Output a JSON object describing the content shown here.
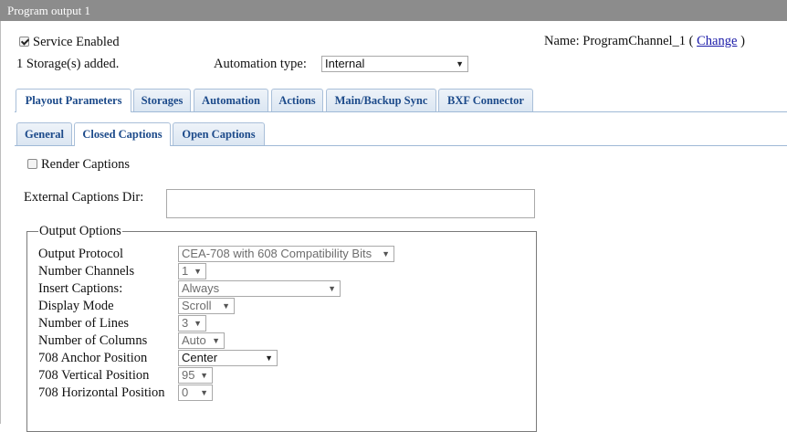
{
  "window": {
    "title": "Program output 1"
  },
  "service": {
    "enabled_label": "Service Enabled",
    "enabled": true,
    "storage_status": "1 Storage(s) added."
  },
  "name": {
    "label": "Name:",
    "value": "ProgramChannel_1",
    "open_paren": "(",
    "change_link": "Change",
    "close_paren": ")"
  },
  "automation": {
    "label": "Automation type:",
    "value": "Internal"
  },
  "main_tabs": [
    {
      "label": "Playout Parameters"
    },
    {
      "label": "Storages"
    },
    {
      "label": "Automation"
    },
    {
      "label": "Actions"
    },
    {
      "label": "Main/Backup Sync"
    },
    {
      "label": "BXF Connector"
    }
  ],
  "sub_tabs": [
    {
      "label": "General"
    },
    {
      "label": "Closed Captions"
    },
    {
      "label": "Open Captions"
    }
  ],
  "captions": {
    "render_label": "Render Captions",
    "render_checked": false,
    "external_dir_label": "External Captions Dir:",
    "external_dir_value": ""
  },
  "output_options": {
    "legend": "Output Options",
    "fields": [
      {
        "label": "Output Protocol",
        "value": "CEA-708 with 608 Compatibility Bits",
        "disabled": true
      },
      {
        "label": "Number Channels",
        "value": "1",
        "disabled": true
      },
      {
        "label": "Insert Captions:",
        "value": "Always",
        "disabled": true
      },
      {
        "label": "Display Mode",
        "value": "Scroll",
        "disabled": true
      },
      {
        "label": "Number of Lines",
        "value": "3",
        "disabled": true
      },
      {
        "label": "Number of Columns",
        "value": "Auto",
        "disabled": true
      },
      {
        "label": "708 Anchor Position",
        "value": "Center",
        "disabled": false
      },
      {
        "label": "708 Vertical Position",
        "value": "95",
        "disabled": true
      },
      {
        "label": "708 Horizontal Position",
        "value": "0",
        "disabled": true
      }
    ]
  },
  "icons": {
    "dropdown": "chevron-down-icon",
    "checkbox": "checkbox-icon"
  }
}
